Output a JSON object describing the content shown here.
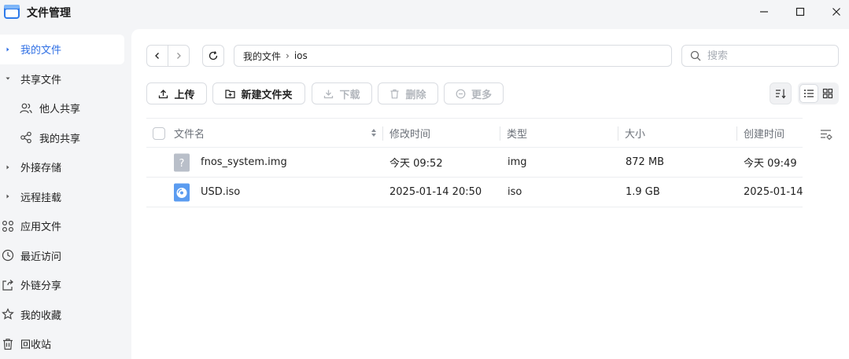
{
  "window": {
    "title": "文件管理",
    "icons": [
      "app-folder-icon",
      "minimize-icon",
      "maximize-icon",
      "close-icon"
    ]
  },
  "sidebar": {
    "items": [
      {
        "label": "我的文件",
        "active": true,
        "icon": "caret-right-icon"
      },
      {
        "label": "共享文件",
        "icon": "caret-down-icon"
      },
      {
        "label": "他人共享",
        "icon": "people-icon"
      },
      {
        "label": "我的共享",
        "icon": "share-icon"
      },
      {
        "label": "外接存储",
        "icon": "caret-right-icon"
      },
      {
        "label": "远程挂载",
        "icon": "caret-right-icon"
      },
      {
        "label": "应用文件",
        "icon": "apps-icon"
      },
      {
        "label": "最近访问",
        "icon": "clock-icon"
      },
      {
        "label": "外链分享",
        "icon": "external-link-icon"
      },
      {
        "label": "我的收藏",
        "icon": "star-icon"
      },
      {
        "label": "回收站",
        "icon": "trash-icon"
      }
    ]
  },
  "address": {
    "breadcrumb": [
      "我的文件",
      "ios"
    ],
    "separator": "›"
  },
  "search": {
    "placeholder": "搜索",
    "value": ""
  },
  "toolbar": {
    "upload": "上传",
    "new_folder": "新建文件夹",
    "download": "下载",
    "delete": "删除",
    "more": "更多"
  },
  "table": {
    "columns": {
      "name": "文件名",
      "mtime": "修改时间",
      "type": "类型",
      "size": "大小",
      "ctime": "创建时间"
    },
    "rows": [
      {
        "name": "fnos_system.img",
        "mtime": "今天 09:52",
        "type": "img",
        "size": "872 MB",
        "ctime": "今天 09:49",
        "icon": "unknown-file-icon"
      },
      {
        "name": "USD.iso",
        "mtime": "2025-01-14 20:50",
        "type": "iso",
        "size": "1.9 GB",
        "ctime": "2025-01-14",
        "icon": "disc-image-icon"
      }
    ]
  },
  "colors": {
    "accent": "#2f6fe4",
    "sidebar_bg": "#f4f5f7",
    "panel_bg": "#ffffff"
  }
}
